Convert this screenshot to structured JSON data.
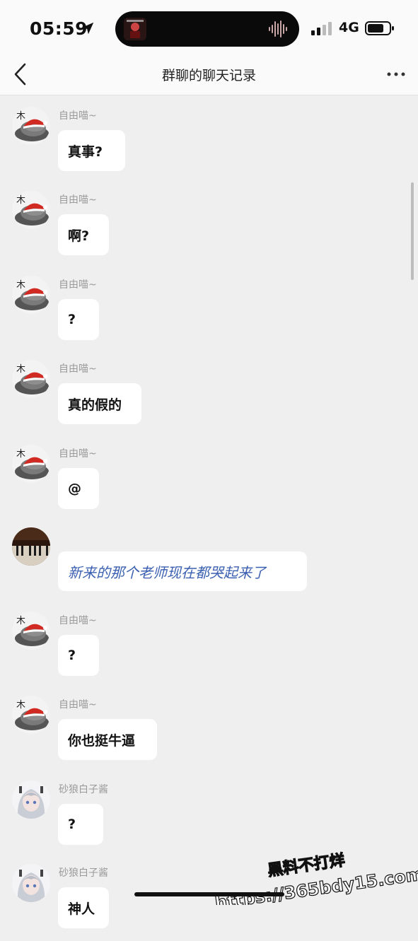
{
  "status_bar": {
    "time": "05:59",
    "network": "4G",
    "icons": [
      "location-arrow-icon",
      "signal-bars-icon",
      "battery-icon",
      "audio-waveform-icon"
    ]
  },
  "nav": {
    "title": "群聊的聊天记录",
    "back_icon": "chevron-left-icon",
    "more_icon": "more-horizontal-icon"
  },
  "messages": [
    {
      "sender": "自由喵~",
      "text": "真事?",
      "avatar": "cat-santa-hat"
    },
    {
      "sender": "自由喵~",
      "text": "啊?",
      "avatar": "cat-santa-hat"
    },
    {
      "sender": "自由喵~",
      "text": "?",
      "avatar": "cat-santa-hat"
    },
    {
      "sender": "自由喵~",
      "text": "真的假的",
      "avatar": "cat-santa-hat"
    },
    {
      "sender": "自由喵~",
      "text": "@",
      "avatar": "cat-santa-hat"
    },
    {
      "sender": "",
      "text": "新来的那个老师现在都哭起来了",
      "avatar": "piano"
    },
    {
      "sender": "自由喵~",
      "text": "?",
      "avatar": "cat-santa-hat"
    },
    {
      "sender": "自由喵~",
      "text": "你也挺牛逼",
      "avatar": "cat-santa-hat"
    },
    {
      "sender": "砂狼白子酱",
      "text": "?",
      "avatar": "anime-girl"
    },
    {
      "sender": "砂狼白子酱",
      "text": "神人",
      "avatar": "anime-girl"
    }
  ],
  "watermark": {
    "line1": "黑料不打烊",
    "line2": "https://365bdy15.com"
  },
  "colors": {
    "background": "#efefef",
    "bubble": "#ffffff",
    "link_text": "#3a5fb0",
    "sender_text": "#9a9a9a"
  }
}
